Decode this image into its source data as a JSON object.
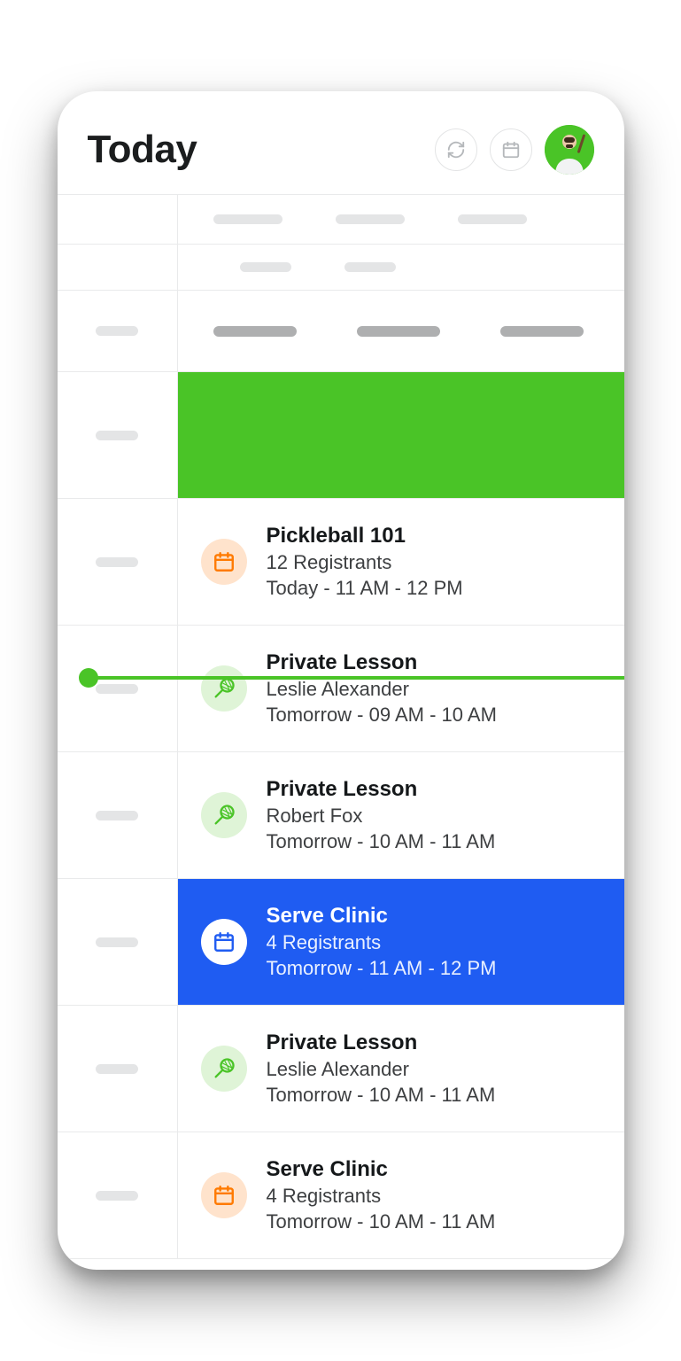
{
  "header": {
    "title": "Today"
  },
  "events": [
    {
      "title": "Pickleball 101",
      "subtitle": "12 Registrants",
      "time": "Today - 11 AM - 12 PM",
      "icon": "calendar",
      "icon_bg": "#FFE3CC",
      "icon_color": "#FF7A00",
      "selected": false
    },
    {
      "title": "Private Lesson",
      "subtitle": "Leslie Alexander",
      "time": "Tomorrow - 09 AM - 10 AM",
      "icon": "racket",
      "icon_bg": "#DFF4D7",
      "icon_color": "#4AC427",
      "selected": false
    },
    {
      "title": "Private Lesson",
      "subtitle": "Robert Fox",
      "time": "Tomorrow - 10 AM - 11 AM",
      "icon": "racket",
      "icon_bg": "#DFF4D7",
      "icon_color": "#4AC427",
      "selected": false
    },
    {
      "title": "Serve Clinic",
      "subtitle": "4 Registrants",
      "time": "Tomorrow - 11 AM - 12 PM",
      "icon": "calendar",
      "icon_bg": "#FFFFFF",
      "icon_color": "#1F5CF2",
      "selected": true
    },
    {
      "title": "Private Lesson",
      "subtitle": "Leslie Alexander",
      "time": "Tomorrow - 10 AM - 11 AM",
      "icon": "racket",
      "icon_bg": "#DFF4D7",
      "icon_color": "#4AC427",
      "selected": false
    },
    {
      "title": "Serve Clinic",
      "subtitle": "4 Registrants",
      "time": "Tomorrow - 10 AM - 11 AM",
      "icon": "calendar",
      "icon_bg": "#FFE3CC",
      "icon_color": "#FF7A00",
      "selected": false
    }
  ]
}
